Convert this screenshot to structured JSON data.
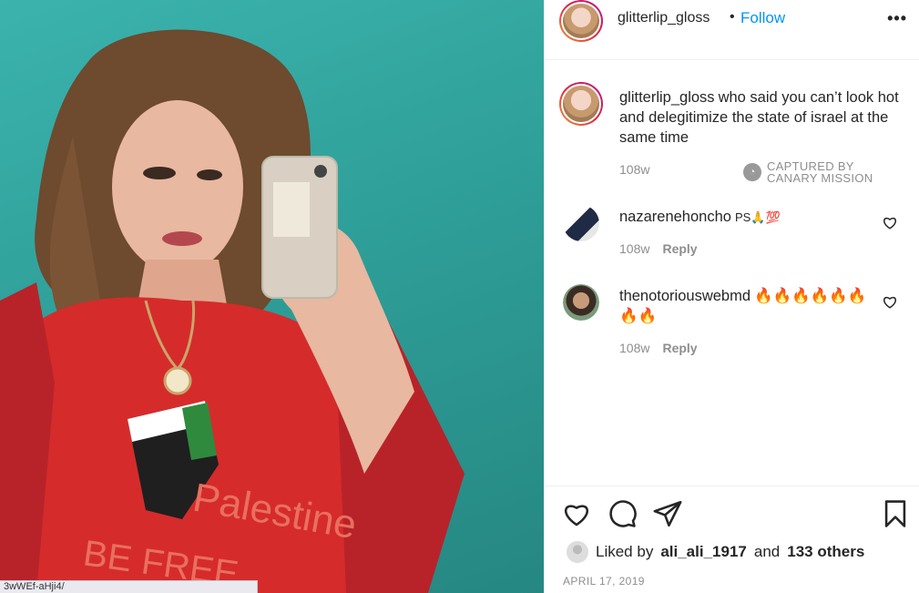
{
  "post": {
    "photo_alt": "",
    "status_url": "3wWEf-aHji4/"
  },
  "header": {
    "username": "glitterlip_gloss",
    "separator": "•",
    "follow_label": "Follow",
    "more_icon": "more-horizontal-icon"
  },
  "caption": {
    "username": "glitterlip_gloss",
    "text": "who said you can’t look hot and delegitimize the state of israel at the same time",
    "age": "108w",
    "stamp_line1": "CAPTURED BY",
    "stamp_line2": "CANARY MISSION"
  },
  "comments": [
    {
      "username": "nazarenehoncho",
      "text": "PS🙏💯",
      "age": "108w",
      "reply_label": "Reply"
    },
    {
      "username": "thenotoriouswebmd",
      "text": "🔥🔥🔥🔥🔥🔥🔥🔥",
      "age": "108w",
      "reply_label": "Reply"
    }
  ],
  "actions": {
    "like_icon": "heart-icon",
    "comment_icon": "comment-icon",
    "share_icon": "paper-plane-icon",
    "save_icon": "bookmark-icon"
  },
  "likes": {
    "prefix": "Liked by",
    "user": "ali_ali_1917",
    "conj": "and",
    "others": "133 others"
  },
  "date": "APRIL 17, 2019",
  "colors": {
    "link": "#0095f6",
    "muted": "#8e8e8e",
    "text": "#262626",
    "photo_bg": "#2f9f99"
  }
}
